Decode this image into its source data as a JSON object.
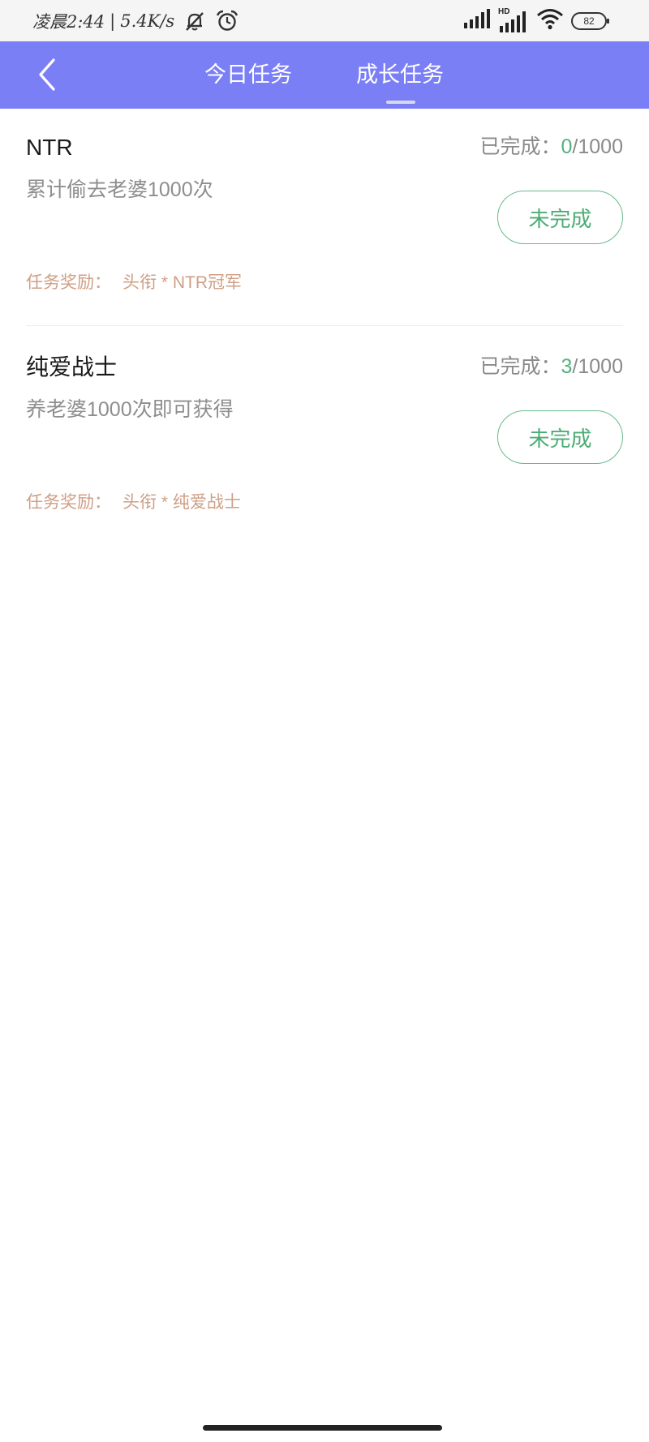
{
  "status_bar": {
    "time": "凌晨2:44",
    "divider": "|",
    "net_speed": "5.4K/s",
    "icons": [
      "notifications-muted-icon",
      "alarm-icon",
      "signal-icon",
      "hd-signal-icon",
      "wifi-icon",
      "battery-icon"
    ],
    "hd_label": "HD",
    "battery_level": "82"
  },
  "header": {
    "back_icon": "chevron-left-icon",
    "tabs": [
      {
        "label": "今日任务",
        "active": false
      },
      {
        "label": "成长任务",
        "active": true
      }
    ]
  },
  "tasks": [
    {
      "title": "NTR",
      "description": "累计偷去老婆1000次",
      "progress_label": "已完成：",
      "done": "0",
      "separator": "/",
      "total": "1000",
      "button_label": "未完成",
      "reward_label": "任务奖励：",
      "reward_value": "头衔 * NTR冠军"
    },
    {
      "title": "纯爱战士",
      "description": "养老婆1000次即可获得",
      "progress_label": "已完成：",
      "done": "3",
      "separator": "/",
      "total": "1000",
      "button_label": "未完成",
      "reward_label": "任务奖励：",
      "reward_value": "头衔 * 纯爱战士"
    }
  ],
  "colors": {
    "header": "#7b7ff6",
    "accent_green": "#55b07d",
    "reward": "#cf9f86",
    "muted_text": "#8e8e8e"
  }
}
